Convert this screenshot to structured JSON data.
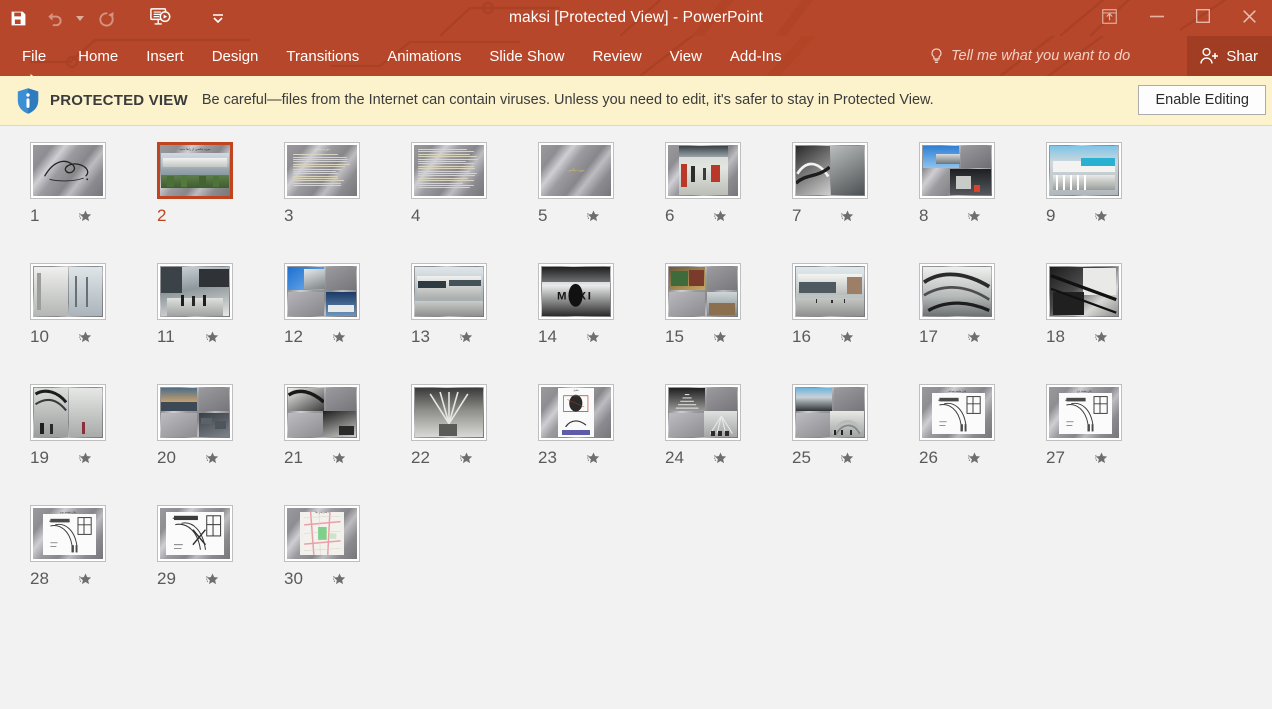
{
  "window": {
    "title": "maksi [Protected View] - PowerPoint",
    "accent_color": "#B7472A",
    "share_button_color": "#A03D22",
    "controls": {
      "ribbon_display_options": "ribbon-display-options",
      "minimize": "minimize",
      "maximize": "maximize",
      "close": "close"
    }
  },
  "quick_access": {
    "items": [
      {
        "name": "save-icon",
        "label": "Save",
        "enabled": true
      },
      {
        "name": "undo-icon",
        "label": "Undo",
        "enabled": false
      },
      {
        "name": "undo-dropdown-icon",
        "label": "Undo options",
        "enabled": false
      },
      {
        "name": "redo-icon",
        "label": "Redo",
        "enabled": false
      },
      {
        "name": "start-slideshow-icon",
        "label": "Start From Beginning",
        "enabled": true
      },
      {
        "name": "customize-qat-icon",
        "label": "Customize Quick Access Toolbar",
        "enabled": true
      }
    ]
  },
  "ribbon": {
    "tabs": [
      {
        "label": "File"
      },
      {
        "label": "Home"
      },
      {
        "label": "Insert"
      },
      {
        "label": "Design"
      },
      {
        "label": "Transitions"
      },
      {
        "label": "Animations"
      },
      {
        "label": "Slide Show"
      },
      {
        "label": "Review"
      },
      {
        "label": "View"
      },
      {
        "label": "Add-Ins"
      }
    ],
    "tell_me": "Tell me what you want to do",
    "share_label": "Shar"
  },
  "protected_view": {
    "label": "PROTECTED VIEW",
    "message": "Be careful—files from the Internet can contain viruses. Unless you need to edit, it's safer to stay in Protected View.",
    "button": "Enable Editing",
    "background": "#FCF3CC",
    "icon": "shield-info-icon"
  },
  "slide_sorter": {
    "selected_slide": 2,
    "slides": [
      {
        "number": "1",
        "star": true,
        "kind": "calligraphy"
      },
      {
        "number": "2",
        "star": false,
        "kind": "titlephoto",
        "title": "موزه مکسی از راها حدید"
      },
      {
        "number": "3",
        "star": false,
        "kind": "textslide",
        "title": "موزه مکسی"
      },
      {
        "number": "4",
        "star": false,
        "kind": "textslide2"
      },
      {
        "number": "5",
        "star": true,
        "kind": "blanktitle"
      },
      {
        "number": "6",
        "star": true,
        "kind": "photo-interior"
      },
      {
        "number": "7",
        "star": true,
        "kind": "photo-pair-dark"
      },
      {
        "number": "8",
        "star": true,
        "kind": "photo-collage-sky"
      },
      {
        "number": "9",
        "star": true,
        "kind": "photo-facade-blue"
      },
      {
        "number": "10",
        "star": true,
        "kind": "photo-pair-white"
      },
      {
        "number": "11",
        "star": true,
        "kind": "photo-lobby"
      },
      {
        "number": "12",
        "star": true,
        "kind": "photo-collage-blue"
      },
      {
        "number": "13",
        "star": true,
        "kind": "photo-exterior"
      },
      {
        "number": "14",
        "star": true,
        "kind": "photo-maxxi-bw"
      },
      {
        "number": "15",
        "star": true,
        "kind": "photo-collage-warm"
      },
      {
        "number": "16",
        "star": true,
        "kind": "photo-plaza"
      },
      {
        "number": "17",
        "star": true,
        "kind": "photo-curves"
      },
      {
        "number": "18",
        "star": true,
        "kind": "photo-dark-diag"
      },
      {
        "number": "19",
        "star": true,
        "kind": "photo-pair-gallery"
      },
      {
        "number": "20",
        "star": true,
        "kind": "photo-collage-aerial"
      },
      {
        "number": "21",
        "star": true,
        "kind": "photo-collage-bw"
      },
      {
        "number": "22",
        "star": true,
        "kind": "photo-ceiling"
      },
      {
        "number": "23",
        "star": true,
        "kind": "diagram-sketch"
      },
      {
        "number": "24",
        "star": true,
        "kind": "photo-collage-stairs"
      },
      {
        "number": "25",
        "star": true,
        "kind": "photo-collage-roof"
      },
      {
        "number": "26",
        "star": true,
        "kind": "plan",
        "title": "پلان طبقه همکف"
      },
      {
        "number": "27",
        "star": true,
        "kind": "plan",
        "title": "پلان طبقه اول"
      },
      {
        "number": "28",
        "star": true,
        "kind": "plan",
        "title": "پلان طبقه دوم"
      },
      {
        "number": "29",
        "star": true,
        "kind": "plan-wide"
      },
      {
        "number": "30",
        "star": true,
        "kind": "map",
        "title": "دسترسی ها"
      }
    ]
  }
}
